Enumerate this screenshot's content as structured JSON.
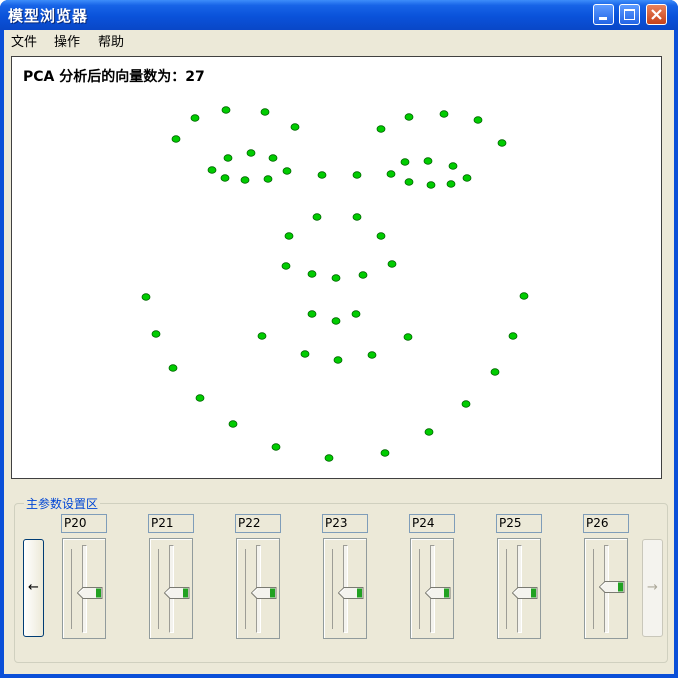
{
  "window": {
    "title": "模型浏览器"
  },
  "menu": [
    "文件",
    "操作",
    "帮助"
  ],
  "canvas": {
    "pca_label": "PCA 分析后的向量数为：27",
    "dot_color": "#00cc00",
    "dot_stroke": "#006600"
  },
  "params_group": {
    "title": "主参数设置区",
    "prev_label": "←",
    "next_label": "→",
    "sliders": [
      {
        "label": "P20",
        "level": 0.5
      },
      {
        "label": "P21",
        "level": 0.5
      },
      {
        "label": "P22",
        "level": 0.5
      },
      {
        "label": "P23",
        "level": 0.5
      },
      {
        "label": "P24",
        "level": 0.5
      },
      {
        "label": "P25",
        "level": 0.5
      },
      {
        "label": "P26",
        "level": 0.55
      }
    ]
  }
}
